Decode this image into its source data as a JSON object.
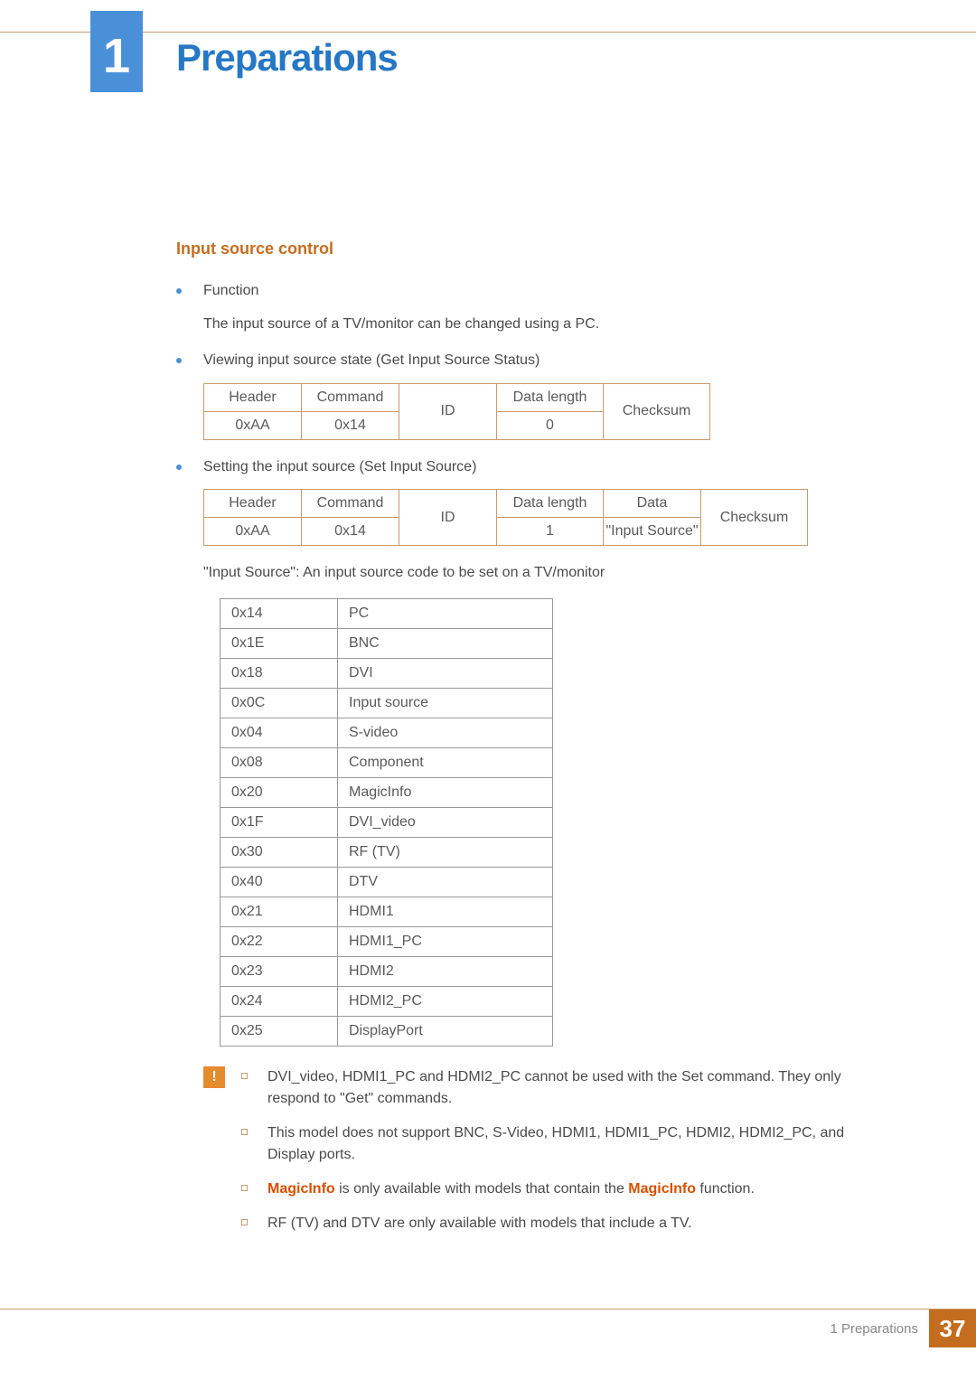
{
  "chapter_number": "1",
  "page_title": "Preparations",
  "section_title": "Input source control",
  "bullets": {
    "b1": "Function",
    "b1_sub": "The input source of a TV/monitor can be changed using a PC.",
    "b2": "Viewing input source state (Get Input Source Status)",
    "b3": "Setting the input source (Set Input Source)"
  },
  "table1": {
    "h1": "Header",
    "h2": "Command",
    "h3": "ID",
    "h4": "Data length",
    "h5": "Checksum",
    "v1": "0xAA",
    "v2": "0x14",
    "v4": "0"
  },
  "table2": {
    "h1": "Header",
    "h2": "Command",
    "h3": "ID",
    "h4": "Data length",
    "h5": "Data",
    "h6": "Checksum",
    "v1": "0xAA",
    "v2": "0x14",
    "v4": "1",
    "v5": "\"Input Source\""
  },
  "caption": "\"Input Source\": An input source code to be set on a TV/monitor",
  "codes": [
    {
      "c": "0x14",
      "n": "PC"
    },
    {
      "c": "0x1E",
      "n": "BNC"
    },
    {
      "c": "0x18",
      "n": "DVI"
    },
    {
      "c": "0x0C",
      "n": "Input source"
    },
    {
      "c": "0x04",
      "n": "S-video"
    },
    {
      "c": "0x08",
      "n": "Component"
    },
    {
      "c": "0x20",
      "n": "MagicInfo"
    },
    {
      "c": "0x1F",
      "n": "DVI_video"
    },
    {
      "c": "0x30",
      "n": "RF (TV)"
    },
    {
      "c": "0x40",
      "n": "DTV"
    },
    {
      "c": "0x21",
      "n": "HDMI1"
    },
    {
      "c": "0x22",
      "n": "HDMI1_PC"
    },
    {
      "c": "0x23",
      "n": "HDMI2"
    },
    {
      "c": "0x24",
      "n": "HDMI2_PC"
    },
    {
      "c": "0x25",
      "n": "DisplayPort"
    }
  ],
  "notes": {
    "n1": "DVI_video, HDMI1_PC and HDMI2_PC cannot be used with the Set command. They only respond to \"Get\" commands.",
    "n2": "This model does not support BNC, S-Video, HDMI1, HDMI1_PC, HDMI2, HDMI2_PC, and Display ports.",
    "n3_hl1": "MagicInfo",
    "n3_mid": " is only available with models that contain the ",
    "n3_hl2": "MagicInfo",
    "n3_end": " function.",
    "n4": "RF (TV) and DTV are only available with models that include a TV."
  },
  "footer": {
    "text": "1 Preparations",
    "page": "37"
  }
}
